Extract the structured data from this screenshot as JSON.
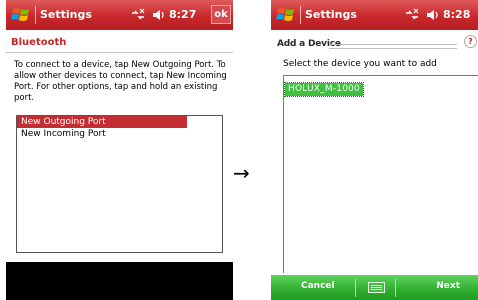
{
  "screen1": {
    "titlebar": {
      "title": "Settings",
      "clock": "8:27",
      "ok_label": "ok"
    },
    "heading": "Bluetooth",
    "intro": "To connect to a device, tap New Outgoing Port. To allow other devices to connect, tap New Incoming Port. For other options, tap and hold an existing port.",
    "ports": [
      {
        "label": "New Outgoing Port",
        "selected": true
      },
      {
        "label": "New Incoming Port",
        "selected": false
      }
    ]
  },
  "arrow": "→",
  "screen2": {
    "titlebar": {
      "title": "Settings",
      "clock": "8:28"
    },
    "dialog_title": "Add a Device",
    "help_icon_label": "?",
    "prompt": "Select the device you want to add",
    "devices": [
      {
        "label": "HOLUX_M-1000",
        "selected": true
      }
    ],
    "softkeys": {
      "left": "Cancel",
      "right": "Next"
    }
  },
  "icons": {
    "logo": "windows-flag-icon",
    "connectivity": "connectivity-icon",
    "volume": "speaker-icon"
  },
  "colors": {
    "titlebar_red": "#c8282c",
    "selection_red": "#c42e32",
    "heading_red": "#c0282c",
    "device_green": "#3fc03f",
    "softkey_green": "#2fae2f"
  }
}
